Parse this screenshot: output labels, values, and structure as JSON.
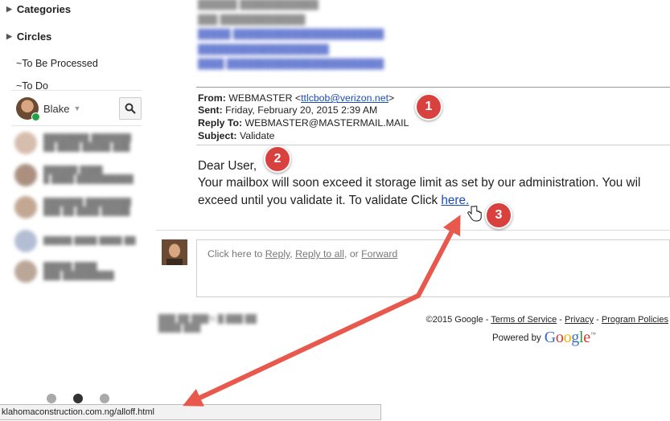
{
  "sidebar": {
    "labels": [
      {
        "label": "Categories"
      },
      {
        "label": "Circles"
      },
      {
        "label": "~To Be Processed"
      },
      {
        "label": "~To Do"
      }
    ]
  },
  "chat": {
    "user_name": "Blake",
    "search_icon": "search-icon"
  },
  "email": {
    "from_label": "From:",
    "from_name": "WEBMASTER <",
    "from_email": "ttlcbob@verizon.net",
    "from_close": ">",
    "sent_label": "Sent:",
    "sent_value": "Friday, February 20, 2015 2:39 AM",
    "reply_to_label": "Reply To:",
    "reply_to_value": "WEBMASTER@MASTERMAIL.MAIL",
    "subject_label": "Subject:",
    "subject_value": "Validate",
    "greeting": "Dear User,",
    "body_line1": "Your mailbox will soon exceed it storage limit as set by our administration. You wil",
    "body_line2_prefix": "exceed until you validate it. To validate Click ",
    "body_link": "here."
  },
  "reply": {
    "prefix": "Click here to ",
    "reply": "Reply",
    "sep1": ", ",
    "reply_all": "Reply to all",
    "sep2": ", or ",
    "forward": "Forward"
  },
  "footer": {
    "copyright": "©2015 Google - ",
    "terms": "Terms of Service",
    "dash1": " - ",
    "privacy": "Privacy",
    "dash2": " - ",
    "program": "Program Policies",
    "powered_by": "Powered by",
    "google_letters": [
      "G",
      "o",
      "o",
      "g",
      "l",
      "e"
    ],
    "google_colors": [
      "#3b6ec9",
      "#d3392f",
      "#f0b400",
      "#3b6ec9",
      "#2a9a3d",
      "#d3392f"
    ],
    "tm": "™"
  },
  "status_bar": {
    "url": "klahomaconstruction.com.ng/alloff.html"
  },
  "annotations": {
    "badge1": "1",
    "badge2": "2",
    "badge3": "3",
    "badge_color": "#d9413f",
    "arrow_color": "#e8584c"
  }
}
